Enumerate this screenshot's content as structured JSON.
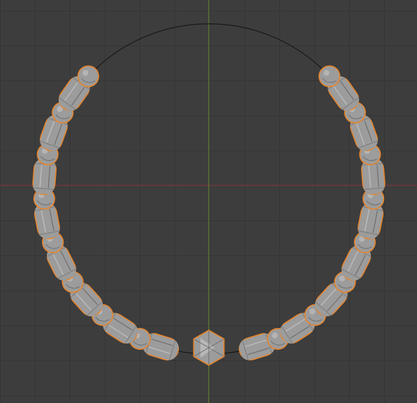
{
  "viewport": {
    "background": "#3d3d3d",
    "grid_color": "#353535",
    "x_axis_color": "#8b3a40",
    "y_axis_color": "#6a8a30"
  },
  "necklace": {
    "curve_color": "#111111",
    "bead_fill": "#9c9c9c",
    "bead_shade": "#6e6e6e",
    "bead_highlight": "#c4c4c4",
    "selection_outline": "#e8852c",
    "pendant_shape": "icosahedron",
    "bead_pattern": [
      "sphere",
      "capsule"
    ],
    "spheres_per_side": 8,
    "capsules_per_side": 8
  }
}
